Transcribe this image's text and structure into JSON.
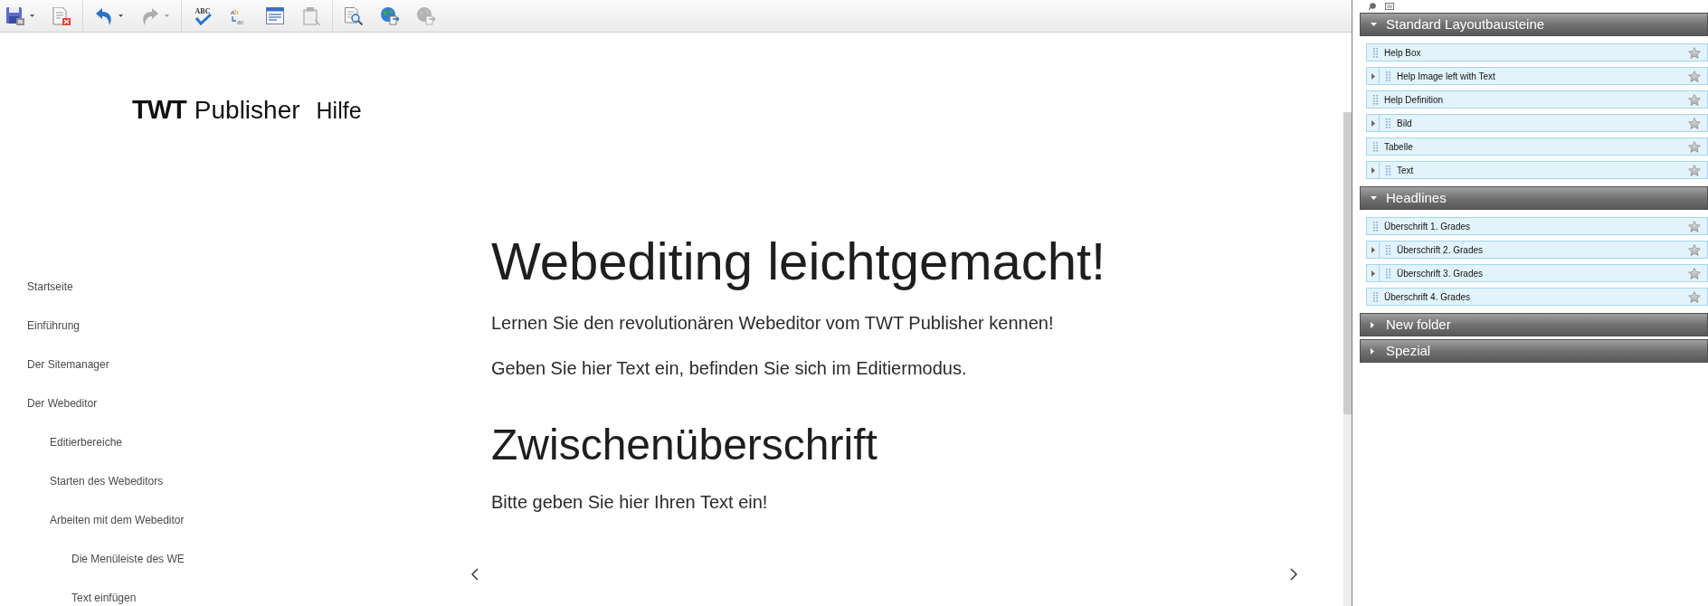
{
  "toolbar": {
    "groups": [
      {
        "items": [
          {
            "kind": "save",
            "disabled": false,
            "dropdown": true
          },
          {
            "kind": "discard",
            "disabled": false
          }
        ]
      },
      {
        "items": [
          {
            "kind": "undo",
            "disabled": false,
            "dropdown": true
          },
          {
            "kind": "redo",
            "disabled": true,
            "dropdown": true
          }
        ]
      },
      {
        "items": [
          {
            "kind": "spellcheck",
            "disabled": false,
            "icon_text": [
              "ABC"
            ]
          },
          {
            "kind": "replace",
            "disabled": false,
            "icon_text": [
              "ab",
              "ac"
            ]
          },
          {
            "kind": "layout",
            "disabled": false
          },
          {
            "kind": "paste",
            "disabled": true
          }
        ]
      },
      {
        "items": [
          {
            "kind": "preview",
            "disabled": false
          },
          {
            "kind": "globe",
            "disabled": false
          },
          {
            "kind": "globe",
            "disabled": true
          }
        ]
      }
    ]
  },
  "site": {
    "logo": {
      "brand": "TWT",
      "product": "Publisher",
      "suffix": "Hilfe"
    },
    "nav": [
      {
        "label": "Startseite"
      },
      {
        "label": "Einführung"
      },
      {
        "label": "Der Sitemanager"
      },
      {
        "label": "Der Webeditor",
        "children": [
          {
            "label": "Editierbereiche"
          },
          {
            "label": "Starten des Webeditors"
          },
          {
            "label": "Arbeiten mit dem Webeditor",
            "children": [
              {
                "label": "Die Menüleiste des WE"
              },
              {
                "label": "Text einfügen"
              }
            ]
          }
        ]
      }
    ],
    "content": [
      {
        "kind": "heading",
        "text": "Webediting leichtgemacht!"
      },
      {
        "kind": "paragraph",
        "text": "Lernen Sie den revolutionären Webeditor vom TWT Publisher kennen!"
      },
      {
        "kind": "paragraph",
        "text": "Geben Sie hier Text ein, befinden Sie sich im Editiermodus."
      },
      {
        "kind": "subheading",
        "text": "Zwischenüberschrift"
      },
      {
        "kind": "paragraph",
        "text": "Bitte geben Sie hier Ihren Text ein!"
      }
    ]
  },
  "panel": {
    "sections": [
      {
        "title": "Standard Layoutbausteine",
        "expanded": true,
        "items": [
          {
            "label": "Help Box",
            "expandable": false
          },
          {
            "label": "Help Image left with Text",
            "expandable": true
          },
          {
            "label": "Help Definition",
            "expandable": false
          },
          {
            "label": "Bild",
            "expandable": true
          },
          {
            "label": "Tabelle",
            "expandable": false
          },
          {
            "label": "Text",
            "expandable": true
          }
        ]
      },
      {
        "title": "Headlines",
        "expanded": true,
        "items": [
          {
            "label": "Überschrift 1. Grades",
            "expandable": false
          },
          {
            "label": "Überschrift 2. Grades",
            "expandable": true
          },
          {
            "label": "Überschrift 3. Grades",
            "expandable": true
          },
          {
            "label": "Überschrift 4. Grades",
            "expandable": false
          }
        ]
      },
      {
        "title": "New folder",
        "expanded": false
      },
      {
        "title": "Spezial",
        "expanded": false
      }
    ]
  }
}
